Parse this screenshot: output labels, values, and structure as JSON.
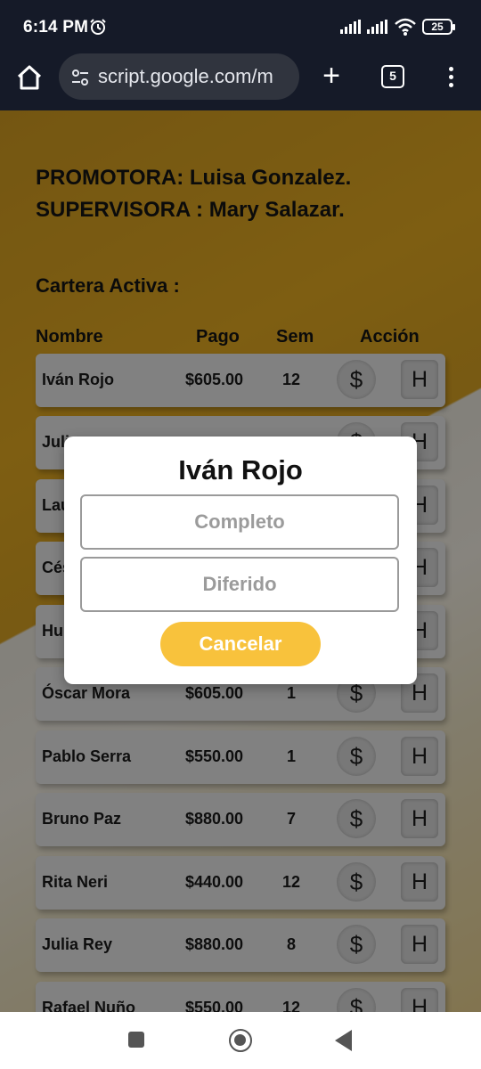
{
  "status_bar": {
    "time": "6:14 PM",
    "battery": "25"
  },
  "browser": {
    "url": "script.google.com/m",
    "tab_count": "5",
    "new_tab_symbol": "+"
  },
  "page": {
    "header_line1": "PROMOTORA: Luisa Gonzalez.",
    "header_line2": "SUPERVISORA : Mary Salazar.",
    "section_title": "Cartera Activa :",
    "columns": {
      "nombre": "Nombre",
      "pago": "Pago",
      "sem": "Sem",
      "accion": "Acción"
    },
    "rows": [
      {
        "nombre": "Iván Rojo",
        "pago": "$605.00",
        "sem": "12",
        "pay_symbol": "$",
        "hist_symbol": "H"
      },
      {
        "nombre": "Juli",
        "pago": "",
        "sem": "",
        "pay_symbol": "$",
        "hist_symbol": "H"
      },
      {
        "nombre": "Lau",
        "pago": "",
        "sem": "",
        "pay_symbol": "$",
        "hist_symbol": "H"
      },
      {
        "nombre": "Cés",
        "pago": "",
        "sem": "",
        "pay_symbol": "$",
        "hist_symbol": "H"
      },
      {
        "nombre": "Hu",
        "pago": "",
        "sem": "",
        "pay_symbol": "$",
        "hist_symbol": "H"
      },
      {
        "nombre": "Óscar Mora",
        "pago": "$605.00",
        "sem": "1",
        "pay_symbol": "$",
        "hist_symbol": "H"
      },
      {
        "nombre": "Pablo Serra",
        "pago": "$550.00",
        "sem": "1",
        "pay_symbol": "$",
        "hist_symbol": "H"
      },
      {
        "nombre": "Bruno Paz",
        "pago": "$880.00",
        "sem": "7",
        "pay_symbol": "$",
        "hist_symbol": "H"
      },
      {
        "nombre": "Rita Neri",
        "pago": "$440.00",
        "sem": "12",
        "pay_symbol": "$",
        "hist_symbol": "H"
      },
      {
        "nombre": "Julia Rey",
        "pago": "$880.00",
        "sem": "8",
        "pay_symbol": "$",
        "hist_symbol": "H"
      },
      {
        "nombre": "Rafael Nuño",
        "pago": "$550.00",
        "sem": "12",
        "pay_symbol": "$",
        "hist_symbol": "H"
      }
    ]
  },
  "modal": {
    "title": "Iván Rojo",
    "option_complete": "Completo",
    "option_deferred": "Diferido",
    "cancel_label": "Cancelar",
    "cancel_color": "#f8c23c"
  }
}
